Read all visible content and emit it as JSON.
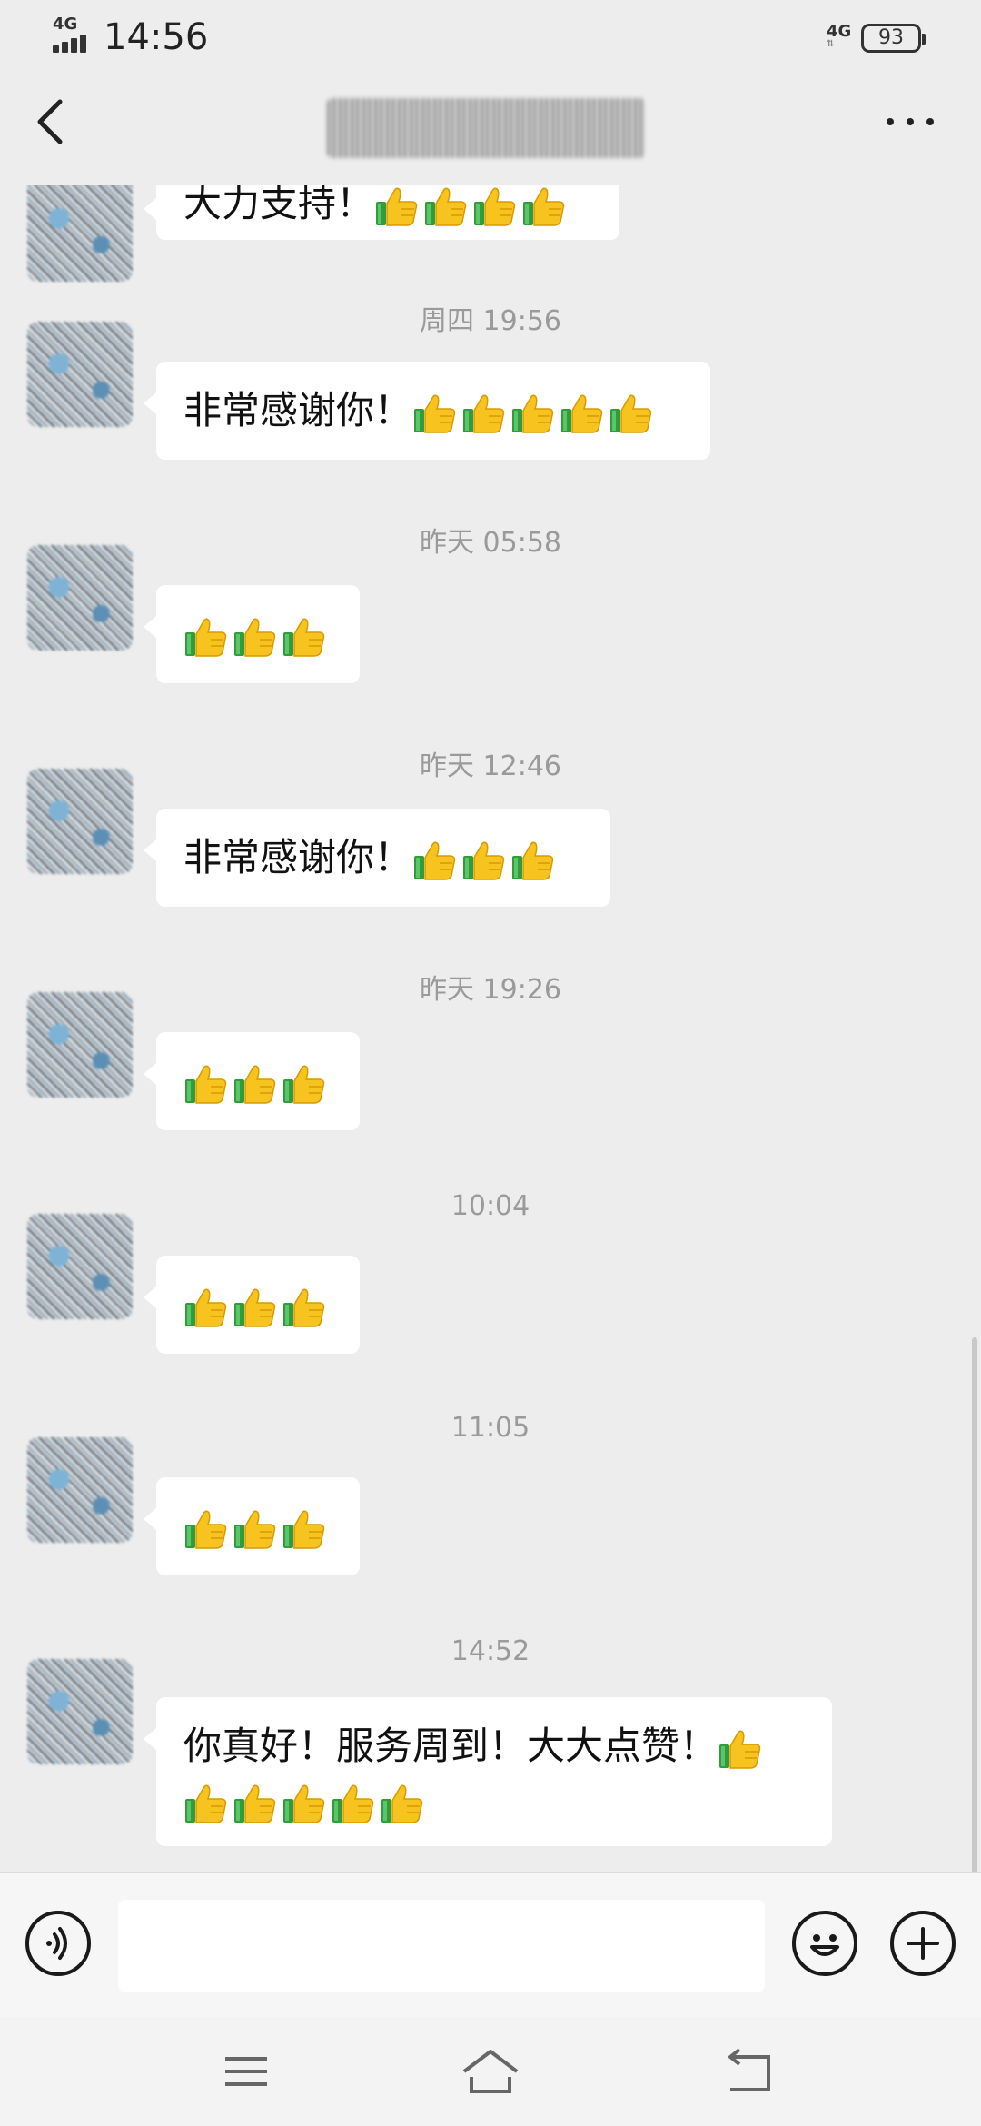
{
  "status_bar": {
    "network": "4G",
    "time": "14:56",
    "network_right": "4G",
    "battery": "93"
  },
  "header": {
    "more_icon": "more-icon",
    "back_icon": "back-icon"
  },
  "messages": [
    {
      "type": "partial",
      "text": "大力支持！"
    },
    {
      "timestamp": "周四 19:56",
      "text": "非常感谢你！",
      "thumbs": 5
    },
    {
      "timestamp": "昨天 05:58",
      "text": "",
      "thumbs": 3
    },
    {
      "timestamp": "昨天 12:46",
      "text": "非常感谢你！",
      "thumbs": 3
    },
    {
      "timestamp": "昨天 19:26",
      "text": "",
      "thumbs": 3
    },
    {
      "timestamp": "10:04",
      "text": "",
      "thumbs": 3
    },
    {
      "timestamp": "11:05",
      "text": "",
      "thumbs": 3
    },
    {
      "timestamp": "14:52",
      "text": "你真好！服务周到！大大点赞！",
      "thumbs": 6
    }
  ],
  "input_bar": {
    "placeholder": ""
  },
  "nav": {
    "menu": "menu-icon",
    "home": "home-icon",
    "back": "return-icon"
  }
}
